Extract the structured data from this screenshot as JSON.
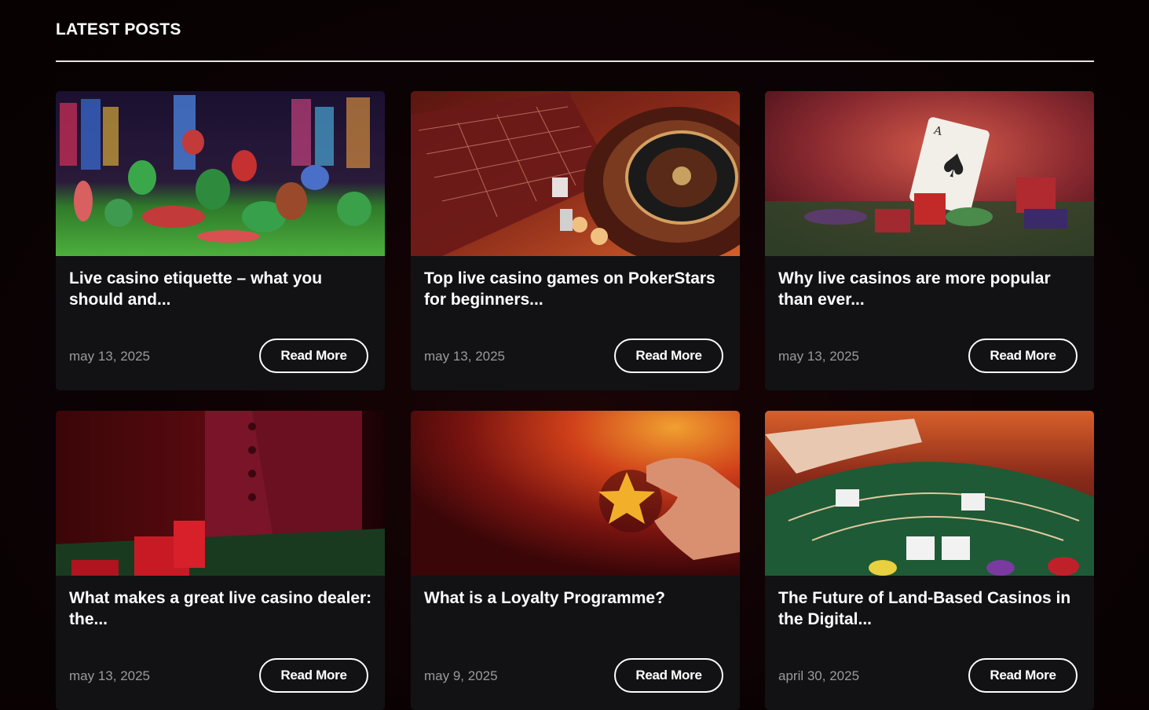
{
  "section": {
    "title": "LATEST POSTS"
  },
  "posts": [
    {
      "title": "Live casino etiquette – what you should and...",
      "date": "may 13, 2025",
      "button": "Read More",
      "image": "casino-chips-slots-image"
    },
    {
      "title": "Top live casino games on PokerStars for beginners...",
      "date": "may 13, 2025",
      "button": "Read More",
      "image": "roulette-table-image"
    },
    {
      "title": "Why live casinos are more popular than ever...",
      "date": "may 13, 2025",
      "button": "Read More",
      "image": "ace-of-spades-chips-image"
    },
    {
      "title": "What makes a great live casino dealer: the...",
      "date": "may 13, 2025",
      "button": "Read More",
      "image": "casino-dealer-vest-image"
    },
    {
      "title": "What is a Loyalty Programme?",
      "date": "may 9, 2025",
      "button": "Read More",
      "image": "hand-holding-star-image"
    },
    {
      "title": "The Future of Land-Based Casinos in the Digital...",
      "date": "april 30, 2025",
      "button": "Read More",
      "image": "blackjack-table-image"
    }
  ],
  "colors": {
    "background": "#0a0103",
    "card": "#121214",
    "text": "#ffffff",
    "muted": "#9a9a9c"
  }
}
